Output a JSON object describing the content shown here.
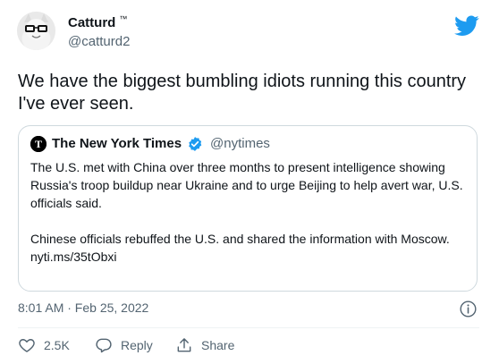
{
  "author": {
    "name": "Catturd",
    "tm": "™",
    "handle": "@catturd2"
  },
  "tweet": {
    "text": "We have the biggest bumbling idiots running this country I've ever seen."
  },
  "quote": {
    "name": "The New York Times",
    "handle": "@nytimes",
    "paragraph1": "The U.S. met with China over three months to present intelligence showing Russia's troop buildup near Ukraine and to urge Beijing to help avert war, U.S. officials said.",
    "paragraph2": "Chinese officials rebuffed the U.S. and shared the information with Moscow.",
    "link": "nyti.ms/35tObxi"
  },
  "meta": {
    "timestamp": "8:01 AM · Feb 25, 2022"
  },
  "actions": {
    "like_count": "2.5K",
    "reply_label": "Reply",
    "share_label": "Share"
  },
  "colors": {
    "twitter_blue": "#1d9bf0",
    "secondary_text": "#536471",
    "border": "#cfd9de"
  },
  "icons": [
    "twitter-bird-icon",
    "verified-badge-icon",
    "info-icon",
    "heart-icon",
    "reply-icon",
    "share-icon"
  ]
}
